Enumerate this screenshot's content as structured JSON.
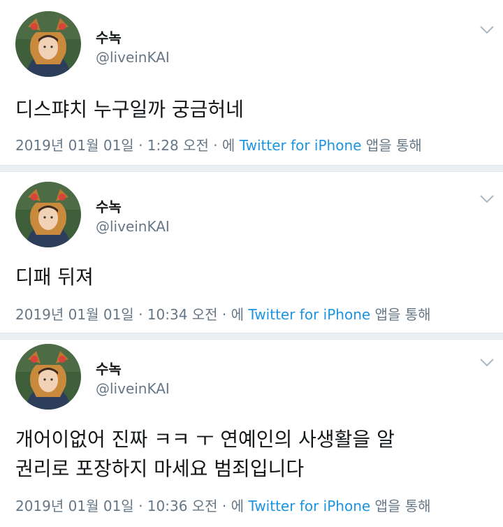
{
  "tweets": [
    {
      "name": "수녹",
      "handle": "@liveinKAI",
      "text": "디스퍄치 누구일까 궁금허네",
      "date": "2019년 01월 01일 · 1:28 오전 · 에 ",
      "source": "Twitter for iPhone",
      "via_suffix": " 앱을 통해"
    },
    {
      "name": "수녹",
      "handle": "@liveinKAI",
      "text": "디패 뒤져",
      "date": "2019년 01월 01일 · 10:34 오전 · 에 ",
      "source": "Twitter for iPhone",
      "via_suffix": " 앱을 통해"
    },
    {
      "name": "수녹",
      "handle": "@liveinKAI",
      "text": "개어이없어 진짜 ㅋㅋ ㅜ 연예인의 사생활을 알\n권리로 포장하지 마세요 범죄입니다",
      "date": "2019년 01월 01일 · 10:36 오전 · 에 ",
      "source": "Twitter for iPhone",
      "via_suffix": " 앱을 통해"
    }
  ],
  "icons": {
    "chevron": "chevron-down-icon",
    "avatar": "avatar"
  },
  "colors": {
    "link": "#1b95e0",
    "meta": "#657786",
    "text": "#14171a",
    "divider": "#eceff1"
  }
}
